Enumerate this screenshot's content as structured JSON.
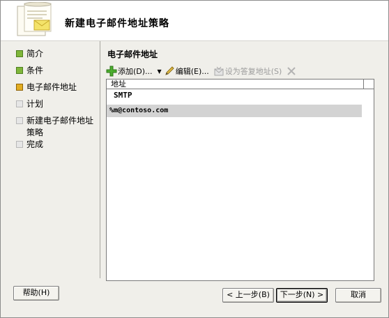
{
  "window": {
    "title": "新建电子邮件地址策略"
  },
  "nav": {
    "items": [
      {
        "label": "简介",
        "state": "done"
      },
      {
        "label": "条件",
        "state": "done"
      },
      {
        "label": "电子邮件地址",
        "state": "current"
      },
      {
        "label": "计划",
        "state": "pending"
      },
      {
        "label": "新建电子邮件地址策略",
        "state": "pending"
      },
      {
        "label": "完成",
        "state": "pending"
      }
    ]
  },
  "main": {
    "section_title": "电子邮件地址",
    "toolbar": {
      "add_label": "添加(D)...",
      "edit_label": "编辑(E)...",
      "set_reply_label": "设为答复地址(S)"
    },
    "list": {
      "column_header": "地址",
      "group_label": "SMTP",
      "addresses": [
        "%m@contoso.com"
      ]
    }
  },
  "footer": {
    "help_label": "帮助(H)",
    "back_label": "< 上一步(B)",
    "next_label": "下一步(N) >",
    "cancel_label": "取消"
  },
  "colors": {
    "step_done": "#7fb63a",
    "step_current": "#e2ad22",
    "step_pending": "#e6e6e6",
    "selected_row": "#d3d3d3"
  }
}
